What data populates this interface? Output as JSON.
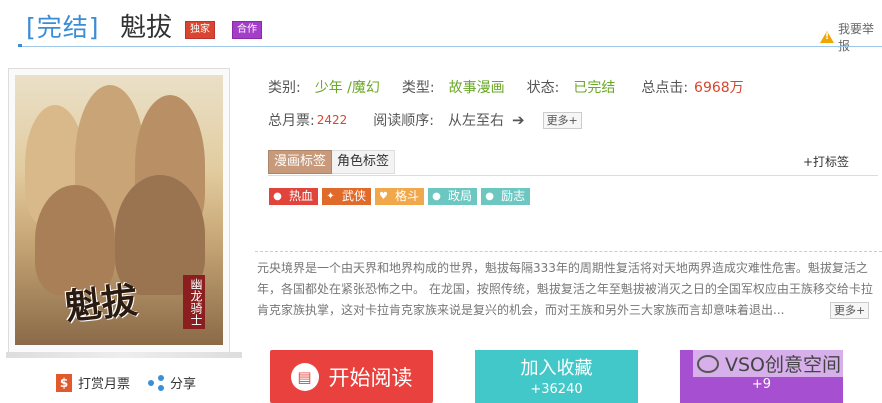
{
  "header": {
    "status_label": "[完结]",
    "title": "魁拔",
    "badge_exclusive": "独家",
    "badge_collab": "合作",
    "report_label": "我要举报"
  },
  "cover": {
    "logo_text": "魁拔",
    "subtitle": "幽龙骑士"
  },
  "cover_actions": {
    "monthly_ticket": "打赏月票",
    "share": "分享"
  },
  "info": {
    "category_label": "类别:",
    "category_value": "少年 /魔幻",
    "type_label": "类型:",
    "type_value": "故事漫画",
    "state_label": "状态:",
    "state_value": "已完结",
    "total_clicks_label": "总点击:",
    "total_clicks_value": "6968万",
    "monthly_votes_label": "总月票:",
    "monthly_votes_value": "2422",
    "reading_order_label": "阅读顺序:",
    "reading_order_value": "从左至右",
    "more_label": "更多+"
  },
  "tags": {
    "tab_comic": "漫画标签",
    "tab_character": "角色标签",
    "add_label": "+打标签",
    "items": [
      {
        "label": "热血",
        "color": "#e0443a",
        "icon": "drop-icon"
      },
      {
        "label": "武侠",
        "color": "#e06a2a",
        "icon": "runner-icon"
      },
      {
        "label": "格斗",
        "color": "#f1a84a",
        "icon": "heart-icon"
      },
      {
        "label": "政局",
        "color": "#6cc7c1",
        "icon": "bubble-icon"
      },
      {
        "label": "励志",
        "color": "#6cc7c1",
        "icon": "bubble-icon"
      }
    ]
  },
  "description": {
    "text": "元央境界是一个由天界和地界构成的世界，魁拔每隔333年的周期性复活将对天地两界造成灾难性危害。魁拔复活之年，各国都处在紧张恐怖之中。 在龙国，按照传统，魁拔复活之年至魁拔被消灭之日的全国军权应由王族移交给卡拉肯克家族执掌，这对卡拉肯克家族来说是复兴的机会，而对王族和另外三大家族而言却意味着退出...",
    "more_label": "更多+"
  },
  "buttons": {
    "read_label": "开始阅读",
    "favorite_label": "加入收藏",
    "favorite_count": "+36240",
    "vote_count": "+9"
  },
  "watermark": {
    "text": "VSO创意空间"
  }
}
